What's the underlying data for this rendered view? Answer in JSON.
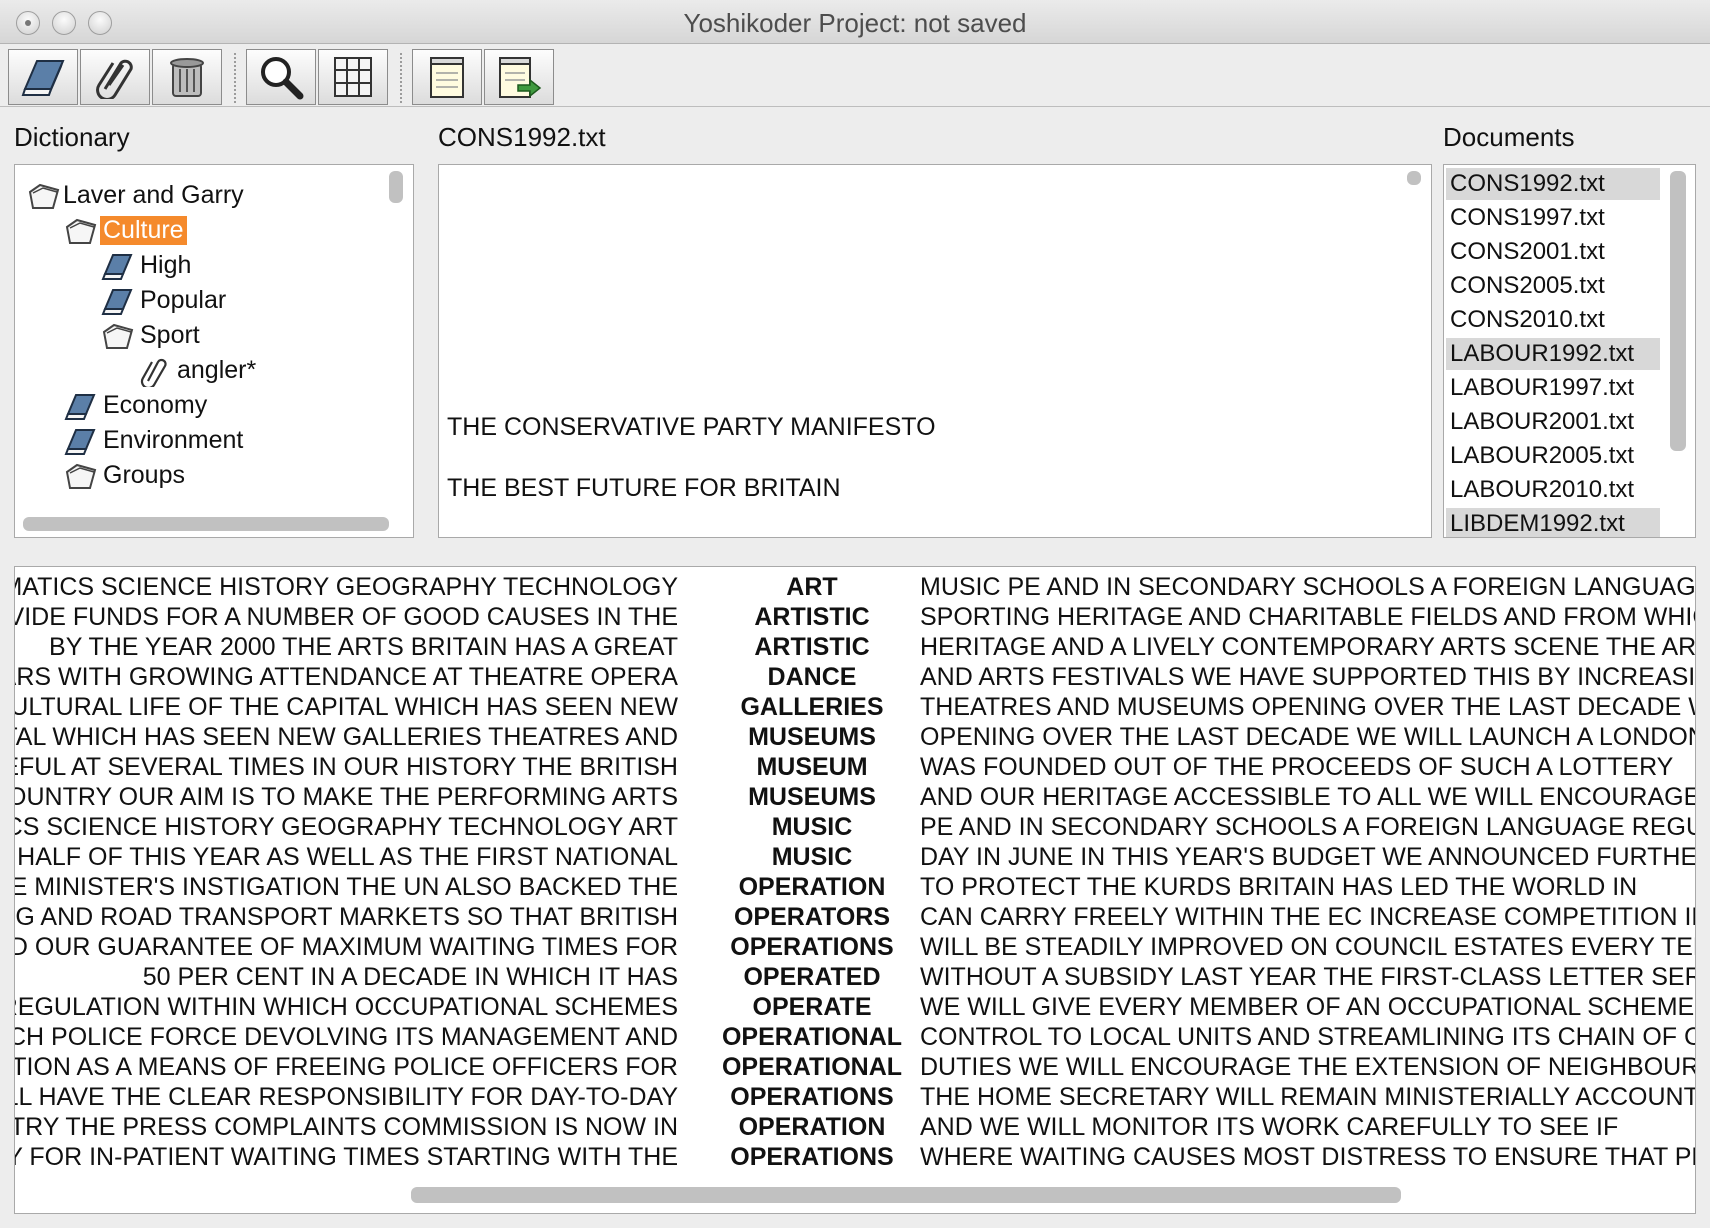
{
  "window": {
    "title": "Yoshikoder Project: not saved"
  },
  "toolbar": {
    "buttons": [
      {
        "name": "dictionary-button",
        "icon": "book-icon"
      },
      {
        "name": "pattern-button",
        "icon": "paperclip-icon"
      },
      {
        "name": "delete-button",
        "icon": "trash-icon"
      },
      {
        "name": "concordance-button",
        "icon": "magnifier-icon"
      },
      {
        "name": "compare-button",
        "icon": "grid-icon"
      },
      {
        "name": "report-button",
        "icon": "notepad-icon"
      },
      {
        "name": "export-button",
        "icon": "export-notepad-icon"
      }
    ]
  },
  "dictionary": {
    "label": "Dictionary",
    "tree": [
      {
        "label": "Laver and Garry",
        "icon": "folder-icon",
        "level": 0,
        "disclosure": "none"
      },
      {
        "label": "Culture",
        "icon": "folder-icon",
        "level": 1,
        "disclosure": "down",
        "selected": true
      },
      {
        "label": "High",
        "icon": "book-icon",
        "level": 2,
        "disclosure": "right"
      },
      {
        "label": "Popular",
        "icon": "book-icon",
        "level": 2,
        "disclosure": "right"
      },
      {
        "label": "Sport",
        "icon": "folder-icon",
        "level": 2,
        "disclosure": "down"
      },
      {
        "label": "angler*",
        "icon": "paperclip-icon",
        "level": 3,
        "disclosure": "none"
      },
      {
        "label": "Economy",
        "icon": "book-icon",
        "level": 1,
        "disclosure": "right"
      },
      {
        "label": "Environment",
        "icon": "book-icon",
        "level": 1,
        "disclosure": "right"
      },
      {
        "label": "Groups",
        "icon": "folder-icon",
        "level": 1,
        "disclosure": "down"
      }
    ]
  },
  "document": {
    "label": "CONS1992.txt",
    "lines": [
      "THE CONSERVATIVE PARTY MANIFESTO",
      "THE BEST FUTURE FOR BRITAIN"
    ]
  },
  "documents": {
    "label": "Documents",
    "items": [
      {
        "name": "CONS1992.txt",
        "highlighted": true
      },
      {
        "name": "CONS1997.txt",
        "highlighted": false
      },
      {
        "name": "CONS2001.txt",
        "highlighted": false
      },
      {
        "name": "CONS2005.txt",
        "highlighted": false
      },
      {
        "name": "CONS2010.txt",
        "highlighted": false
      },
      {
        "name": "LABOUR1992.txt",
        "highlighted": true
      },
      {
        "name": "LABOUR1997.txt",
        "highlighted": false
      },
      {
        "name": "LABOUR2001.txt",
        "highlighted": false
      },
      {
        "name": "LABOUR2005.txt",
        "highlighted": false
      },
      {
        "name": "LABOUR2010.txt",
        "highlighted": false
      },
      {
        "name": "LIBDEM1992.txt",
        "highlighted": true
      }
    ]
  },
  "concordance": {
    "rows": [
      {
        "left": "THEMATICS SCIENCE HISTORY GEOGRAPHY TECHNOLOGY",
        "key": "ART",
        "right": "MUSIC PE AND IN SECONDARY SCHOOLS A FOREIGN LANGUAGE"
      },
      {
        "left": "PROVIDE FUNDS FOR A NUMBER OF GOOD CAUSES IN THE",
        "key": "ARTISTIC",
        "right": "SPORTING HERITAGE AND CHARITABLE FIELDS AND FROM WHIC"
      },
      {
        "left": "BY THE YEAR 2000 THE ARTS BRITAIN HAS A GREAT",
        "key": "ARTISTIC",
        "right": "HERITAGE AND A LIVELY CONTEMPORARY ARTS SCENE THE ART"
      },
      {
        "left": "YEARS WITH GROWING ATTENDANCE AT THEATRE OPERA",
        "key": "DANCE",
        "right": "AND ARTS FESTIVALS WE HAVE SUPPORTED THIS BY INCREASING"
      },
      {
        "left": "S CULTURAL LIFE OF THE CAPITAL WHICH HAS SEEN NEW",
        "key": "GALLERIES",
        "right": "THEATRES AND MUSEUMS OPENING OVER THE LAST DECADE WE"
      },
      {
        "left": "CAPITAL WHICH HAS SEEN NEW GALLERIES THEATRES AND",
        "key": "MUSEUMS",
        "right": "OPENING OVER THE LAST DECADE WE WILL LAUNCH A LONDON"
      },
      {
        "left": "USEFUL AT SEVERAL TIMES IN OUR HISTORY THE BRITISH",
        "key": "MUSEUM",
        "right": "WAS FOUNDED OUT OF THE PROCEEDS OF SUCH A LOTTERY"
      },
      {
        "left": "COUNTRY OUR AIM IS TO MAKE THE PERFORMING ARTS",
        "key": "MUSEUMS",
        "right": "AND OUR HERITAGE ACCESSIBLE TO ALL WE WILL ENCOURAGE T"
      },
      {
        "left": "MATICS SCIENCE HISTORY GEOGRAPHY TECHNOLOGY ART",
        "key": "MUSIC",
        "right": "PE AND IN SECONDARY SCHOOLS A FOREIGN LANGUAGE REGULA"
      },
      {
        "left": "HALF OF THIS YEAR AS WELL AS THE FIRST NATIONAL",
        "key": "MUSIC",
        "right": "DAY IN JUNE IN THIS YEAR'S BUDGET WE ANNOUNCED FURTHER"
      },
      {
        "left": "PRIME MINISTER'S INSTIGATION THE UN ALSO BACKED THE",
        "key": "OPERATION",
        "right": "TO PROTECT THE KURDS BRITAIN HAS LED THE WORLD IN"
      },
      {
        "left": "PING AND ROAD TRANSPORT MARKETS SO THAT BRITISH",
        "key": "OPERATORS",
        "right": "CAN CARRY FREELY WITHIN THE EC INCREASE COMPETITION IN"
      },
      {
        "left": "AND OUR GUARANTEE OF MAXIMUM WAITING TIMES FOR",
        "key": "OPERATIONS",
        "right": "WILL BE STEADILY IMPROVED ON COUNCIL ESTATES EVERY TENA"
      },
      {
        "left": "50 PER CENT IN A DECADE IN WHICH IT HAS",
        "key": "OPERATED",
        "right": "WITHOUT A SUBSIDY LAST YEAR THE FIRST-CLASS LETTER SERVI"
      },
      {
        "left": "D REGULATION WITHIN WHICH OCCUPATIONAL SCHEMES",
        "key": "OPERATE",
        "right": "WE WILL GIVE EVERY MEMBER OF AN OCCUPATIONAL SCHEME TI"
      },
      {
        "left": "EACH POLICE FORCE DEVOLVING ITS MANAGEMENT AND",
        "key": "OPERATIONAL",
        "right": "CONTROL TO LOCAL UNITS AND STREAMLINING ITS CHAIN OF C"
      },
      {
        "left": "NISATION AS A MEANS OF FREEING POLICE OFFICERS FOR",
        "key": "OPERATIONAL",
        "right": "DUTIES WE WILL ENCOURAGE THE EXTENSION OF NEIGHBOURHO"
      },
      {
        "left": "WILL HAVE THE CLEAR RESPONSIBILITY FOR DAY-TO-DAY",
        "key": "OPERATIONS",
        "right": "THE HOME SECRETARY WILL REMAIN MINISTERIALLY ACCOUNTA"
      },
      {
        "left": "DUSTRY THE PRESS COMPLAINTS COMMISSION IS NOW IN",
        "key": "OPERATION",
        "right": "AND WE WILL MONITOR ITS WORK CAREFULLY TO SEE IF"
      },
      {
        "left": "LY FOR IN-PATIENT WAITING TIMES STARTING WITH THE",
        "key": "OPERATIONS",
        "right": "WHERE WAITING CAUSES MOST DISTRESS TO ENSURE THAT PRO"
      }
    ]
  }
}
